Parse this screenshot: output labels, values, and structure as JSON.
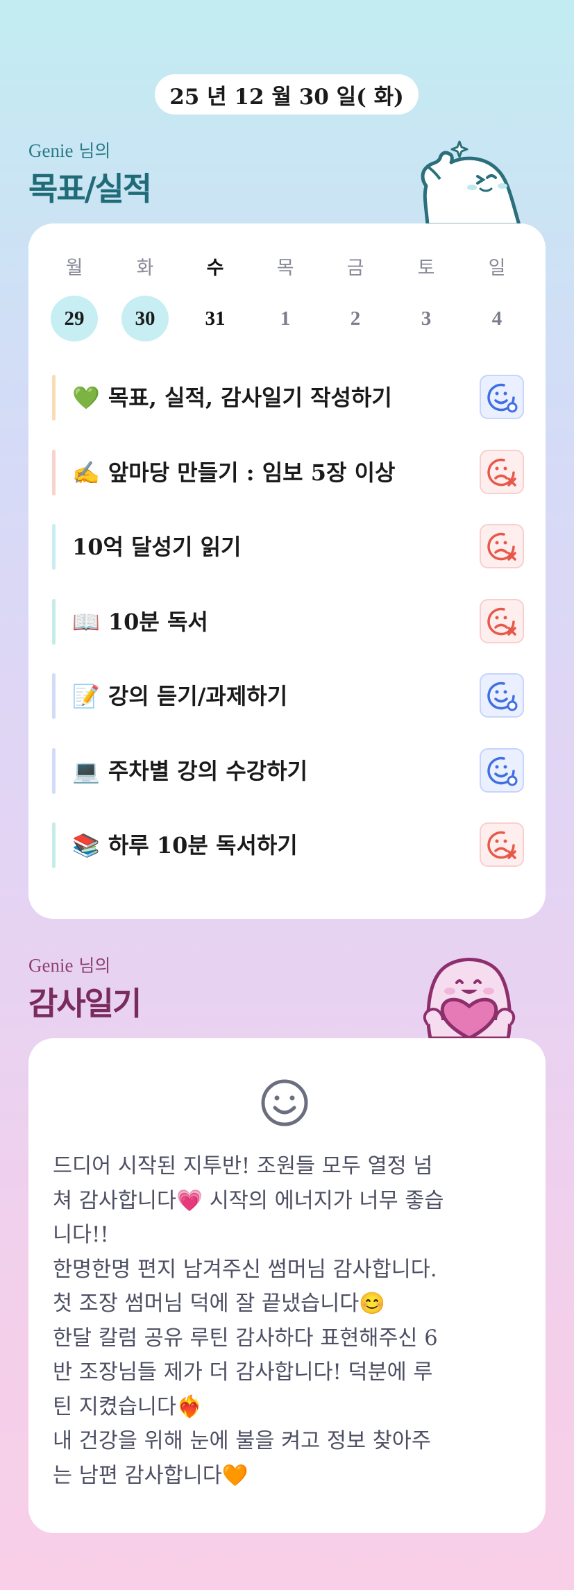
{
  "header": {
    "date": "25 년 12 월 30 일( 화)"
  },
  "goals_section": {
    "user_name": "Genie",
    "suffix": "님의",
    "title": "목표/실적"
  },
  "week": {
    "days": [
      {
        "name": "월",
        "num": "29",
        "state": "past"
      },
      {
        "name": "화",
        "num": "30",
        "state": "past"
      },
      {
        "name": "수",
        "num": "31",
        "state": "today"
      },
      {
        "name": "목",
        "num": "1",
        "state": "future"
      },
      {
        "name": "금",
        "num": "2",
        "state": "future"
      },
      {
        "name": "토",
        "num": "3",
        "state": "future"
      },
      {
        "name": "일",
        "num": "4",
        "state": "future"
      }
    ]
  },
  "goals": [
    {
      "emoji": "💚",
      "text": "목표, 실적, 감사일기 작성하기",
      "status": "done",
      "bar_color": "#f8dcb6"
    },
    {
      "emoji": "✍️",
      "text": "앞마당 만들기 : 임보 5장 이상",
      "status": "missed",
      "bar_color": "#f7d3cd"
    },
    {
      "emoji": "",
      "text": "10억 달성기 읽기",
      "status": "missed",
      "bar_color": "#c8eef2"
    },
    {
      "emoji": "📖",
      "text": "10분 독서",
      "status": "missed",
      "bar_color": "#c5ece6"
    },
    {
      "emoji": "📝",
      "text": "강의 듣기/과제하기",
      "status": "done",
      "bar_color": "#d2dcf6"
    },
    {
      "emoji": "💻",
      "text": "주차별 강의 수강하기",
      "status": "done",
      "bar_color": "#d2dcf6"
    },
    {
      "emoji": "📚",
      "text": "하루 10분 독서하기",
      "status": "missed",
      "bar_color": "#c5ece6"
    }
  ],
  "diary_section": {
    "user_name": "Genie",
    "suffix": "님의",
    "title": "감사일기"
  },
  "diary": {
    "mood_icon": "smile-face-icon",
    "text": "드디어 시작된 지투반! 조원들 모두 열정 넘\n쳐 감사합니다💗 시작의 에너지가 너무 좋습\n니다!!\n한명한명 편지 남겨주신 썸머님 감사합니다.\n첫 조장 썸머님 덕에 잘 끝냈습니다😊\n한달 칼럼 공유 루틴 감사하다 표현해주신 6\n반 조장님들 제가 더 감사합니다! 덕분에 루\n틴 지켰습니다❤️‍🔥\n내 건강을 위해 눈에 불을 켜고 정보 찾아주\n는 남편 감사합니다🧡"
  },
  "colors": {
    "done_icon": "#3f6fe0",
    "missed_icon": "#e8584a",
    "past_day_bg": "#c6eef3",
    "goals_title": "#1f6c78",
    "diary_title": "#7a2b5e"
  }
}
